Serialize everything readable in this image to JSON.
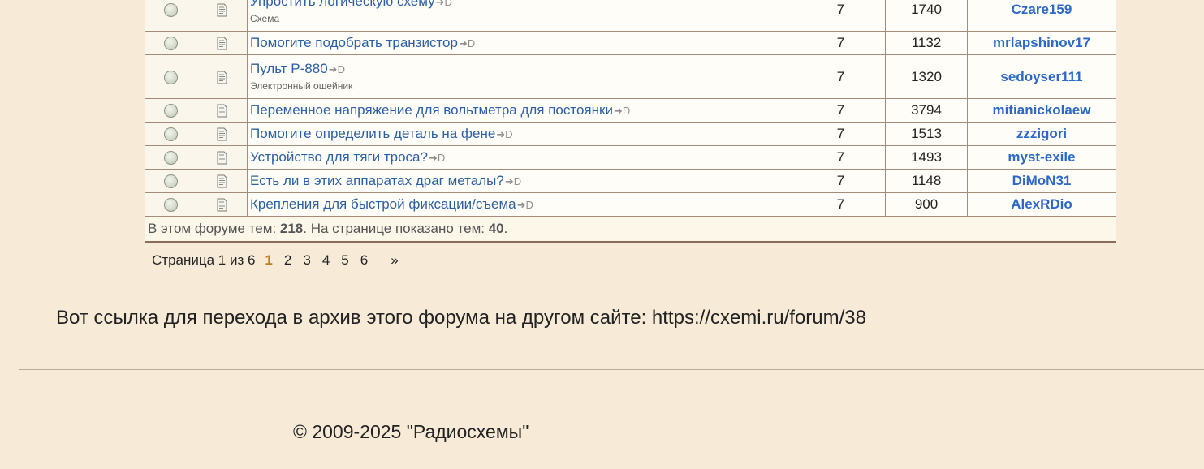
{
  "topics": [
    {
      "title": "Упростить логическую схему",
      "subtitle": "Схема",
      "replies": "7",
      "views": "1740",
      "author": "Czare159"
    },
    {
      "title": "Помогите подобрать транзистор",
      "subtitle": "",
      "replies": "7",
      "views": "1132",
      "author": "mrlapshinov17"
    },
    {
      "title": "Пульт Р-880",
      "subtitle": "Электронный ошейник",
      "replies": "7",
      "views": "1320",
      "author": "sedoyser111"
    },
    {
      "title": "Переменное напряжение для вольтметра для постоянки",
      "subtitle": "",
      "replies": "7",
      "views": "3794",
      "author": "mitianickolaew"
    },
    {
      "title": "Помогите определить деталь на фене",
      "subtitle": "",
      "replies": "7",
      "views": "1513",
      "author": "zzzigori"
    },
    {
      "title": "Устройство для тяги троса?",
      "subtitle": "",
      "replies": "7",
      "views": "1493",
      "author": "myst-exile"
    },
    {
      "title": "Есть ли в этих аппаратах драг металы?",
      "subtitle": "",
      "replies": "7",
      "views": "1148",
      "author": "DiMoN31"
    },
    {
      "title": "Крепления для быстрой фиксации/съема",
      "subtitle": "",
      "replies": "7",
      "views": "900",
      "author": "AlexRDio"
    }
  ],
  "table_footer": {
    "prefix": "В этом форуме тем: ",
    "topics_total": "218",
    "middle": ". На странице показано тем: ",
    "topics_shown": "40",
    "suffix": "."
  },
  "pagination": {
    "label": "Страница 1 из 6",
    "current": "1",
    "pages": [
      "2",
      "3",
      "4",
      "5",
      "6"
    ],
    "next": "»"
  },
  "archive_note": "Вот ссылка для перехода в архив этого форума на другом сайте: https://cxemi.ru/forum/38",
  "copyright": "© 2009-2025 \"Радиосхемы\"",
  "newpost_glyph": "➜D"
}
